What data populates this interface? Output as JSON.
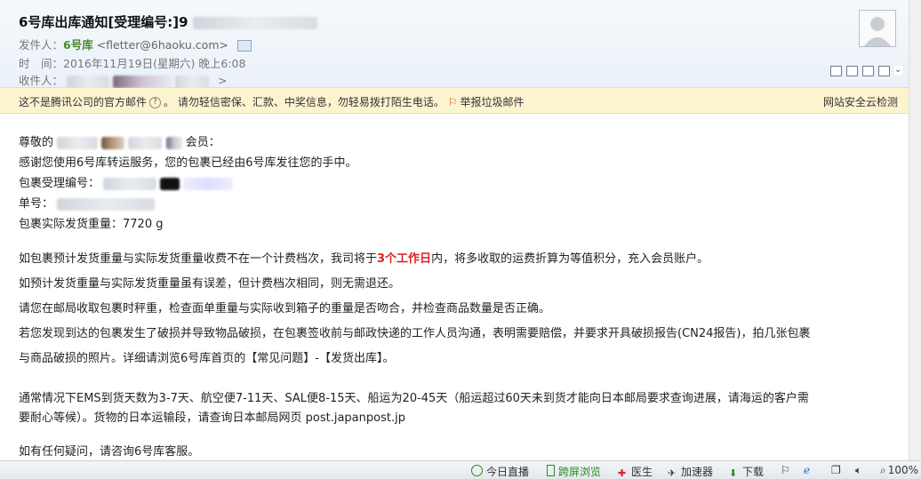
{
  "email": {
    "subject": "6号库出库通知[受理编号:]9",
    "from_label": "发件人：",
    "from_name": "6号库",
    "from_addr": "<fletter@6haoku.com>",
    "time_label": "时　间：",
    "time_value": "2016年11月19日(星期六) 晚上6:08",
    "to_label": "收件人：",
    "to_more": ">"
  },
  "warning": {
    "prefix": "这不是腾讯公司的官方邮件",
    "q": "?",
    "text": "。 请勿轻信密保、汇款、中奖信息，勿轻易拨打陌生电话。",
    "report": "举报垃圾邮件",
    "right": "网站安全云检测"
  },
  "body": {
    "greet_a": "尊敬的",
    "greet_b": "会员：",
    "thanks": "感谢您使用6号库转运服务，您的包裹已经由6号库发往您的手中。",
    "ref_label": "包裹受理编号：",
    "track_label": "单号：",
    "weight": "包裹实际发货重量：7720 g",
    "p1a": "如包裹预计发货重量与实际发货重量收费不在一个计费档次，我司将于",
    "p1red": "3个工作日",
    "p1b": "内，将多收取的运费折算为等值积分，充入会员账户。",
    "p2": "如预计发货重量与实际发货重量虽有误差，但计费档次相同，则无需退还。",
    "p3": "请您在邮局收取包裹时秤重，检查面单重量与实际收到箱子的重量是否吻合，并检查商品数量是否正确。",
    "p4": "若您发现到达的包裹发生了破损并导致物品破损，在包裹签收前与邮政快递的工作人员沟通，表明需要赔偿，并要求开具破损报告(CN24报告)，拍几张包裹",
    "p5": "与商品破损的照片。详细请浏览6号库首页的【常见问题】-【发货出库】。",
    "p6": "通常情况下EMS到货天数为3-7天、航空便7-11天、SAL便8-15天、船运为20-45天（船运超过60天未到货才能向日本邮局要求查询进展，请海运的客户需",
    "p7": "要耐心等候）。货物的日本运输段，请查询日本邮局网页 post.japanpost.jp",
    "p8": "如有任何疑问，请咨询6号库客服。"
  },
  "statusbar": {
    "live": "今日直播",
    "screen": "跨屏浏览",
    "doctor": "医生",
    "accel": "加速器",
    "download": "下载",
    "zoom": "100%"
  }
}
